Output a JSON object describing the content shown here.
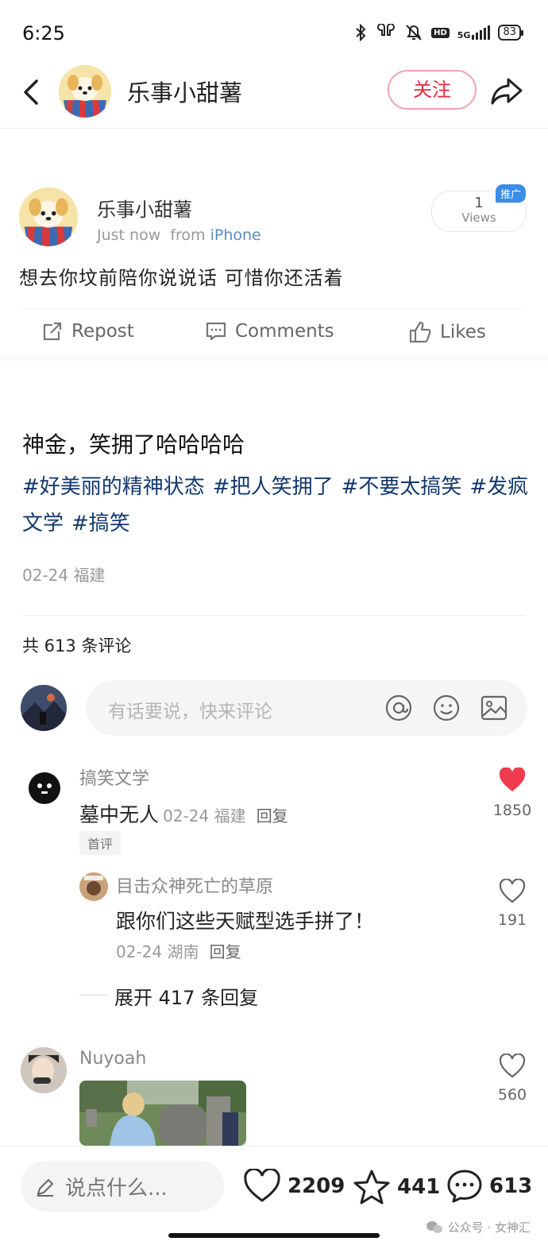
{
  "status_bar": {
    "time": "6:25",
    "network": "5G",
    "hd": "HD",
    "battery": "83"
  },
  "header": {
    "username": "乐事小甜薯",
    "follow_label": "关注"
  },
  "post": {
    "author": "乐事小甜薯",
    "time": "Just now",
    "via_prefix": "from",
    "via_device": "iPhone",
    "views_count": "1",
    "views_label": "Views",
    "promo_badge": "推广",
    "text": "想去你坟前陪你说说话 可惜你还活着",
    "actions": {
      "repost": "Repost",
      "comments": "Comments",
      "likes": "Likes"
    }
  },
  "note": {
    "title": "神金，笑拥了哈哈哈哈",
    "tags": [
      "#好美丽的精神状态",
      "#把人笑拥了",
      "#不要太搞笑",
      "#发疯文学",
      "#搞笑"
    ],
    "date_location": "02-24 福建",
    "comments_total": "共 613 条评论"
  },
  "comment_input": {
    "placeholder": "有话要说，快来评论"
  },
  "comments": [
    {
      "name": "搞笑文学",
      "body": "墓中无人",
      "meta": "02-24 福建",
      "reply_label": "回复",
      "likes": "1850",
      "liked": true,
      "badge": "首评",
      "replies": [
        {
          "name": "目击众神死亡的草原",
          "body": "跟你们这些天赋型选手拼了！",
          "meta": "02-24 湖南",
          "reply_label": "回复",
          "likes": "191"
        }
      ],
      "expand_label": "展开 417 条回复"
    },
    {
      "name": "Nuyoah",
      "likes": "560"
    }
  ],
  "bottom_bar": {
    "placeholder": "说点什么...",
    "likes": "2209",
    "stars": "441",
    "comments": "613"
  },
  "watermark": "公众号 · 女神汇",
  "colors": {
    "accent_red": "#e8273d",
    "tag_blue": "#13386c",
    "link_blue": "#5a8cc0",
    "promo_blue": "#3b8de8"
  }
}
